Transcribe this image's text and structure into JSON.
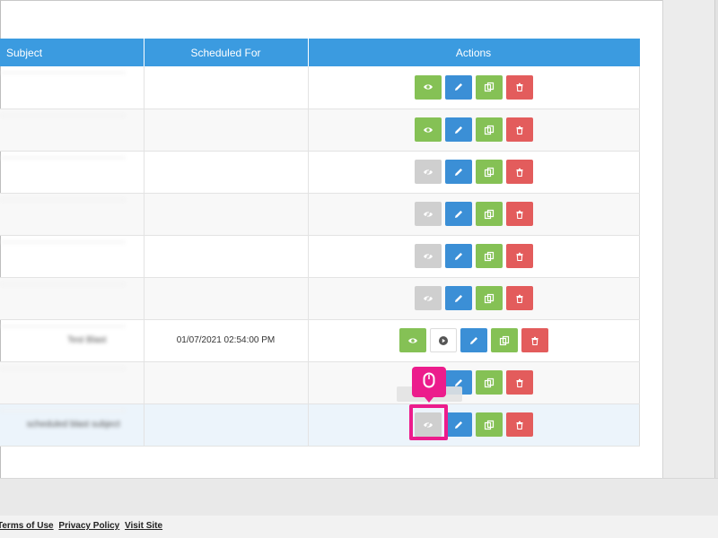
{
  "table": {
    "headers": [
      "Subject",
      "Scheduled For",
      "Actions"
    ],
    "rows": [
      {
        "subject": "",
        "scheduled": "",
        "view_active": true,
        "has_play": false
      },
      {
        "subject": "",
        "scheduled": "",
        "view_active": true,
        "has_play": false
      },
      {
        "subject": "",
        "scheduled": "",
        "view_active": false,
        "has_play": false
      },
      {
        "subject": "",
        "scheduled": "",
        "view_active": false,
        "has_play": false
      },
      {
        "subject": "",
        "scheduled": "",
        "view_active": false,
        "has_play": false
      },
      {
        "subject": "",
        "scheduled": "",
        "view_active": false,
        "has_play": false
      },
      {
        "subject": "Test Blast",
        "scheduled": "01/07/2021 02:54:00 PM",
        "view_active": true,
        "has_play": true
      },
      {
        "subject": "",
        "scheduled": "",
        "view_active": true,
        "has_play": false
      },
      {
        "subject": "scheduled blast subject",
        "scheduled": "",
        "view_active": false,
        "has_play": false
      }
    ]
  },
  "footer": {
    "terms": "Terms of Use",
    "privacy": "Privacy Policy",
    "visit": "Visit Site"
  },
  "icons": {
    "view": "eye-icon",
    "view_disabled": "eye-slash-icon",
    "play": "play-icon",
    "edit": "pencil-icon",
    "copy": "copy-icon",
    "delete": "trash-icon",
    "cursor": "mouse-icon"
  },
  "colors": {
    "header": "#3b9be0",
    "view_green": "#85c155",
    "edit_blue": "#3b8fd6",
    "delete_red": "#e35c5c",
    "disabled_grey": "#cfcfcf",
    "highlight": "#ec1c8c"
  }
}
